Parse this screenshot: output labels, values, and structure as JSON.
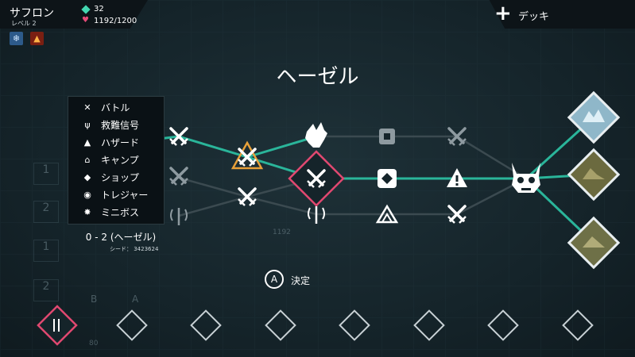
{
  "hero": {
    "name": "サフロン",
    "level": "レベル 2",
    "gems": "32",
    "hp": "1192/1200"
  },
  "buffs": [
    "ice-buff-icon",
    "fire-buff-icon"
  ],
  "deck": {
    "label": "デッキ"
  },
  "map": {
    "title": "ヘーゼル",
    "stage": "0 - 2 (ヘーゼル)",
    "seed": "シード： 3423624",
    "center_value": "1192"
  },
  "legend": [
    {
      "icon": "battle-icon",
      "label": "バトル"
    },
    {
      "icon": "distress-signal-icon",
      "label": "救難信号"
    },
    {
      "icon": "hazard-icon",
      "label": "ハザード"
    },
    {
      "icon": "camp-icon",
      "label": "キャンプ"
    },
    {
      "icon": "shop-icon",
      "label": "ショップ"
    },
    {
      "icon": "treasure-icon",
      "label": "トレジャー"
    },
    {
      "icon": "miniboss-icon",
      "label": "ミニボス"
    }
  ],
  "confirm": {
    "button": "A",
    "label": "決定"
  },
  "ghost": {
    "slot_numbers": [
      "1",
      "2",
      "1",
      "2"
    ],
    "b": "B",
    "a": "A",
    "count": "80"
  },
  "colors": {
    "accent": "#2ab59a",
    "selected": "#e04870",
    "hazard": "#e8a13a"
  }
}
